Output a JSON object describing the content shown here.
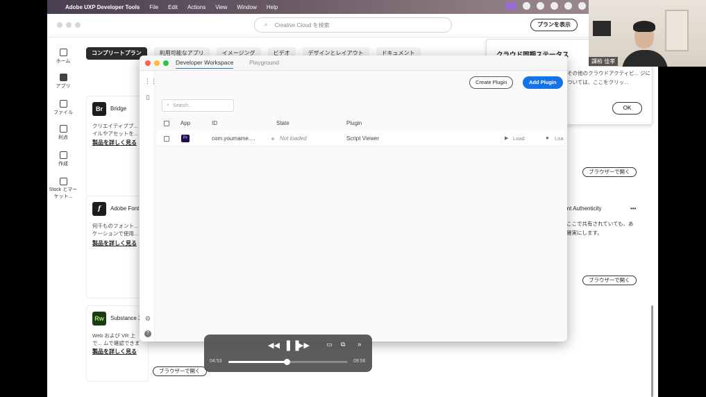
{
  "menubar": {
    "app_name": "Adobe UXP Developer Tools",
    "items": [
      "File",
      "Edit",
      "Actions",
      "View",
      "Window",
      "Help"
    ]
  },
  "cc": {
    "search_placeholder": "Creative Cloud を検索",
    "plan_button": "プランを表示",
    "sidebar": [
      {
        "label": "ホーム",
        "icon": "home-icon"
      },
      {
        "label": "アプリ",
        "icon": "apps-icon"
      },
      {
        "label": "ファイル",
        "icon": "folder-icon"
      },
      {
        "label": "利点",
        "icon": "benefits-icon"
      },
      {
        "label": "作成",
        "icon": "create-icon"
      },
      {
        "label": "Stock とマーケット...",
        "icon": "stock-icon"
      }
    ],
    "tabs": [
      "コンプリートプラン",
      "利用可能なアプリ",
      "イメージング",
      "ビデオ",
      "デザインとレイアウト",
      "ドキュメント"
    ],
    "cards": [
      {
        "logo": "Br",
        "name": "Bridge",
        "desc": "クリエイティブプ... イルやアセットを...",
        "more": "製品を詳しく見る"
      },
      {
        "logo": "f",
        "name": "Adobe Font",
        "desc": "何千ものフォント... ケーションで使用...",
        "more": "製品を詳しく見る"
      },
      {
        "logo": "Rw",
        "name": "Substance 3",
        "desc": "Web および VR 上で... ムで確認できます。",
        "more": "製品を詳しく見る"
      }
    ],
    "browser_button": "ブラウザーで開く",
    "sync_panel": {
      "title": "クラウド同期ステータス",
      "desc": "その他のクラウドアクティビ... ジについては、ここをクリッ...",
      "ok": "OK"
    },
    "right_card": {
      "name": "tent Authenticity",
      "desc_line1": "ここで共有されていても、あ",
      "desc_line2": "確実にします。",
      "menu": "•••"
    }
  },
  "uxp": {
    "tabs": [
      "Developer Workspace",
      "Playground"
    ],
    "create_button": "Create Plugin",
    "add_button": "Add Plugin",
    "search_placeholder": "Search..",
    "columns": [
      "App",
      "ID",
      "State",
      "Plugin"
    ],
    "rows": [
      {
        "app": "Pr",
        "id": "com.yourname.…",
        "state": "Not loaded",
        "plugin": "Script Viewer",
        "action1": "Load",
        "action2": "Loa"
      }
    ]
  },
  "player": {
    "elapsed": "04:53",
    "remaining": "09:56",
    "progress": 0.49
  },
  "webcam": {
    "name": "譯栫 佳孝"
  }
}
